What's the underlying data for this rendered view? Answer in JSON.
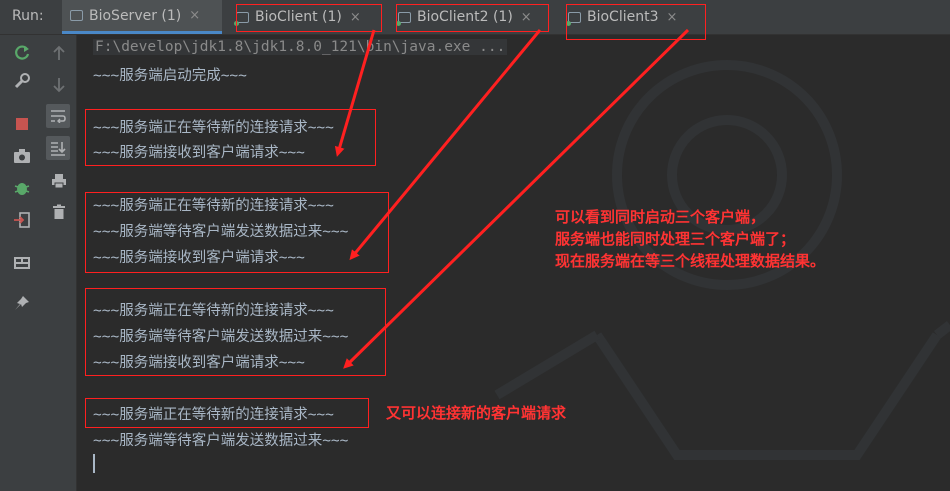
{
  "run": {
    "label": "Run:"
  },
  "tabs": [
    {
      "label": "BioServer (1)",
      "close": "×"
    },
    {
      "label": "BioClient (1)",
      "close": "×"
    },
    {
      "label": "BioClient2 (1)",
      "close": "×"
    },
    {
      "label": "BioClient3",
      "close": "×"
    }
  ],
  "console": {
    "command": "F:\\develop\\jdk1.8\\jdk1.8.0_121\\bin\\java.exe ...",
    "lines": [
      "~~~服务端启动完成~~~",
      "~~~服务端正在等待新的连接请求~~~",
      "~~~服务端接收到客户端请求~~~",
      "~~~服务端正在等待新的连接请求~~~",
      "~~~服务端等待客户端发送数据过来~~~",
      "~~~服务端接收到客户端请求~~~",
      "~~~服务端正在等待新的连接请求~~~",
      "~~~服务端等待客户端发送数据过来~~~",
      "~~~服务端接收到客户端请求~~~",
      "~~~服务端正在等待新的连接请求~~~",
      "~~~服务端等待客户端发送数据过来~~~"
    ]
  },
  "annotations": {
    "note1": [
      "可以看到同时启动三个客户端，",
      "服务端也能同时处理三个客户端了；",
      "现在服务端在等三个线程处理数据结果。"
    ],
    "note2": "又可以连接新的客户端请求",
    "color": "#ff2020"
  },
  "toolbar_icons": [
    "rerun-icon",
    "settings-wrench-icon",
    "stop-icon",
    "camera-icon",
    "debug-bug-icon",
    "exit-icon",
    "layout-icon",
    "pin-icon",
    "up-arrow-icon",
    "down-arrow-icon",
    "soft-wrap-icon",
    "scroll-to-end-icon",
    "print-icon",
    "trash-icon"
  ]
}
